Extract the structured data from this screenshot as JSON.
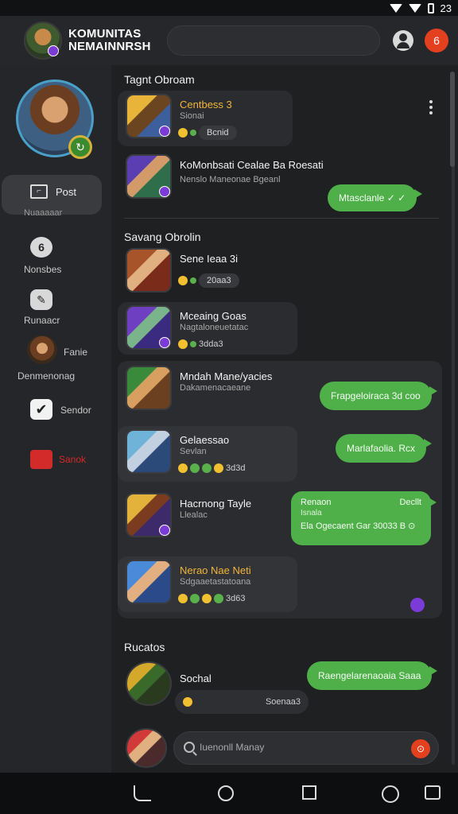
{
  "statusbar": {
    "time": "23"
  },
  "header": {
    "title_line1": "KOMUNITAS",
    "title_line2": "NEMAINNRSH",
    "notif_glyph": "6"
  },
  "sidebar": {
    "items": [
      {
        "label": "Post",
        "sub": "Nuaaaaar",
        "icon": "post-icon"
      },
      {
        "label": "Nonsbes",
        "glyph": "6",
        "icon": "community-icon"
      },
      {
        "label": "Runaacr",
        "glyph": "✎",
        "icon": "chat-icon"
      },
      {
        "label": "Fanie",
        "sub": "Denmenonag",
        "icon": "hero-icon"
      },
      {
        "label": "Sendor",
        "glyph": "✔",
        "icon": "check-icon"
      },
      {
        "label": "Sanok",
        "icon": "store-icon",
        "color": "#d32a2a"
      }
    ]
  },
  "sections": {
    "s1": "Tagnt Obroam",
    "s2": "Savang Obrolin",
    "s3": "Rucatos"
  },
  "threads": [
    {
      "name": "Centbess 3",
      "sub": "Sionai",
      "meta": "Bcnid",
      "name_color": "#f0b53a"
    },
    {
      "name": "KoMonbsati Cealae Ba Roesati",
      "sub": "Nenslo Maneonae Bgeanl",
      "bubble": "Mtasclanle ✓ ✓"
    },
    {
      "name": "Sene Ieaa 3i",
      "meta": "20aa3"
    },
    {
      "name": "Mceaing Goas",
      "sub": "Nagtaloneuetatac",
      "meta": "3dda3"
    },
    {
      "name": "Mndah Mane/yacies",
      "sub": "Dakamenacaeane",
      "bubble": "Frapgeloiraca 3d coo"
    },
    {
      "name": "Gelaessao",
      "sub": "Sevlan",
      "meta": "3d3d",
      "bubble": "Marlafaolia. Rcx"
    },
    {
      "name": "Hacrnong Tayle",
      "sub": "Llealac",
      "bubble_title": "Renaon",
      "bubble_right": "Decllt",
      "bubble_sub": "Isnala",
      "bubble_bottom": "Ela Ogecaent Gar 30033 B ⊙"
    },
    {
      "name": "Nerao Nae Neti",
      "sub": "Sdgaaetastatoana",
      "meta": "3d63",
      "name_color": "#f0b53a"
    },
    {
      "name": "Sochal",
      "meta": "Soenaa3",
      "bubble": "Raengelarenaoaia Saaa"
    }
  ],
  "compose": {
    "placeholder": "Iuenonll Manay",
    "send_glyph": "⊙"
  }
}
